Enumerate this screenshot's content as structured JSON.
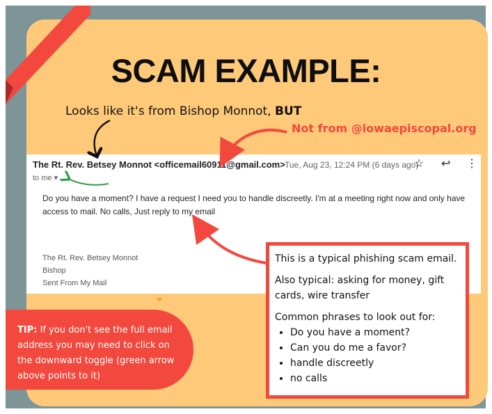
{
  "title": "SCAM EXAMPLE:",
  "callout_top": {
    "text": "Looks like it's from Bishop Monnot, ",
    "emphasis": "BUT"
  },
  "callout_right": "Not from @iowaepiscopal.org",
  "email": {
    "sender": "The Rt. Rev. Betsey Monnot <officemail60911@gmail.com>",
    "date": "Tue, Aug 23, 12:24 PM (6 days ago)",
    "to": "to me",
    "body": "Do you have a moment? I have a request I need you to handle discreetly. I'm at a meeting right now and only have access to mail. No calls, Just reply to my email",
    "signature": [
      "The Rt. Rev. Betsey Monnot",
      "Bishop",
      "Sent From My Mail"
    ]
  },
  "info_box": {
    "line1": "This is a typical phishing scam email.",
    "line2": "Also typical: asking for money, gift cards, wire transfer",
    "line3": "Common phrases to look out for:",
    "phrases": [
      "Do you have a moment?",
      "Can you do me a favor?",
      "handle discreetly",
      "no calls"
    ]
  },
  "tip": {
    "label": "TIP:",
    "text": " If you don't see the full email address you may need to click on the downward toggle  (green arrow above points to it)"
  },
  "icons": [
    "star-icon",
    "reply-icon",
    "more-vert-icon",
    "dropdown-caret-icon"
  ],
  "colors": {
    "background": "#7d9597",
    "card": "#ffc97a",
    "accent": "#f2483e",
    "green_arrow": "#2e9b48"
  }
}
